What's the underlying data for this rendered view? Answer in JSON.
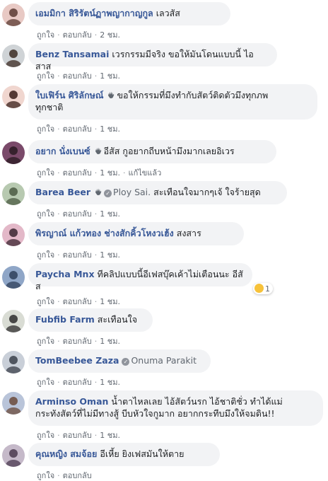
{
  "actions": {
    "like": "ถูกใจ",
    "reply": "ตอบกลับ",
    "separator": "·"
  },
  "comments": [
    {
      "author": "เอมมิกา สิริรัตน์ฏาพญากาญกูล",
      "text": "เลวสัส",
      "time": "2 ชม.",
      "avatar_colors": [
        "#e8c9c4",
        "#5b3a32"
      ]
    },
    {
      "author": "Benz Tansamai",
      "text": "เวรกรรมมีจริง ขอให้มันโดนแบบนี้ ไอสาส",
      "time": "1 ชม.",
      "avatar_colors": [
        "#cfd3d6",
        "#3b2a22"
      ]
    },
    {
      "author": "ใบเฟิร์น ศิริลักษณ์",
      "text_line1": "ขอให้กรรมที่มึงทำกับสัตว์ติดตัวมึงทุกภพ",
      "text_line2": "ทุกชาติ",
      "time": "1 ชม.",
      "avatar_colors": [
        "#f0d6cf",
        "#3a1f1a"
      ]
    },
    {
      "author": "อยาก นั่งเบนซ์",
      "text": "อีสัส กูอยากถีบหน้ามึงมากเลยอิเวร",
      "time": "1 ชม.",
      "edited": "แก้ไขแล้ว",
      "avatar_colors": [
        "#7a4a6a",
        "#2a1a22"
      ]
    },
    {
      "author": "Barea Beer",
      "mention": "Ploy Sai.",
      "text": "สะเทือนใจมากๆเจ้ ใจร้ายสุด",
      "time": "1 ชม.",
      "avatar_colors": [
        "#b7c9b0",
        "#4b5a43"
      ]
    },
    {
      "author": "พิรญาณ์ แก้วทอง ช่างสักคิ้วโหงวเฮ้ง",
      "text": "สงสาร",
      "time": "1 ชม.",
      "avatar_colors": [
        "#e3b8c8",
        "#3b2430"
      ]
    },
    {
      "author": "Paycha Mnx",
      "text": "ทีคลิปแบบนี้อีเฟสบุ๊คเค้าไม่เตือนนะ อีสัส",
      "time": "1 ชม.",
      "reaction_count": "1",
      "avatar_colors": [
        "#8fa6c7",
        "#2f3f5a"
      ]
    },
    {
      "author": "Fubfib Farm",
      "text": "สะเทือนใจ",
      "time": "1 ชม.",
      "avatar_colors": [
        "#d9dcd4",
        "#2d2d2d"
      ]
    },
    {
      "author": "TomBeebee Zaza",
      "mention": "Onuma Parakit",
      "time": "1 ชม.",
      "avatar_colors": [
        "#c9cfd8",
        "#3a3f4a"
      ]
    },
    {
      "author": "Arminso Oman",
      "text_line1": "น้ำตาไหลเลย ไอ้สัตว์นรก ไอ้ชาติชั่ว ทำได้แม่",
      "text_line2": "กระทังสัตว์ที่ไม่มีทางสู้ บีบหัวใจกูมาก อยากกระทีบมึงให้จมดิน!!",
      "time": "1 ชม.",
      "avatar_colors": [
        "#b9c4d9",
        "#6a4a3a"
      ]
    },
    {
      "author": "คุณหญิง สมจ้อย",
      "text": "อีเหี้ย ยิงเฟสมันให้ตาย",
      "time": "",
      "avatar_colors": [
        "#c5b9c9",
        "#4a3a4f"
      ]
    }
  ]
}
